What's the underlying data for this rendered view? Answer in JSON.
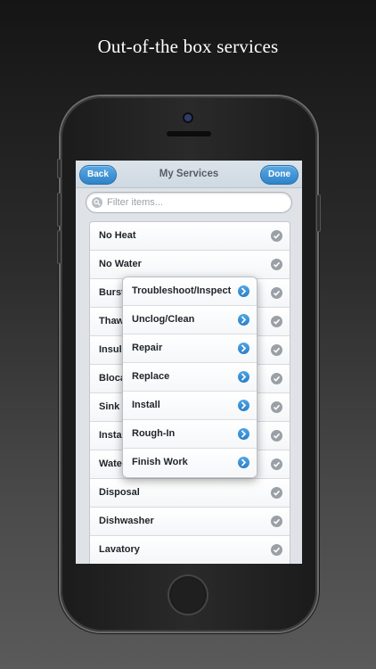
{
  "headline": "Out-of-the box services",
  "navbar": {
    "back_label": "Back",
    "title": "My Services",
    "done_label": "Done"
  },
  "filter": {
    "placeholder": "Filter items..."
  },
  "list": {
    "items": [
      {
        "label": "No Heat"
      },
      {
        "label": "No Water"
      },
      {
        "label": "Burst"
      },
      {
        "label": "Thaw"
      },
      {
        "label": "Insul"
      },
      {
        "label": "Bloca"
      },
      {
        "label": "Sink"
      },
      {
        "label": "Insta"
      },
      {
        "label": "Wate"
      },
      {
        "label": "Disposal"
      },
      {
        "label": "Dishwasher"
      },
      {
        "label": "Lavatory"
      }
    ]
  },
  "popup": {
    "items": [
      {
        "label": "Troubleshoot/Inspect"
      },
      {
        "label": "Unclog/Clean"
      },
      {
        "label": "Repair"
      },
      {
        "label": "Replace"
      },
      {
        "label": "Install"
      },
      {
        "label": "Rough-In"
      },
      {
        "label": "Finish Work"
      }
    ]
  },
  "colors": {
    "accent": "#2f83c9",
    "check": "#9aa0a6"
  },
  "icons": {
    "row_status": "checkmark-icon",
    "popup_row": "chevron-right-icon",
    "filter": "search-icon"
  }
}
